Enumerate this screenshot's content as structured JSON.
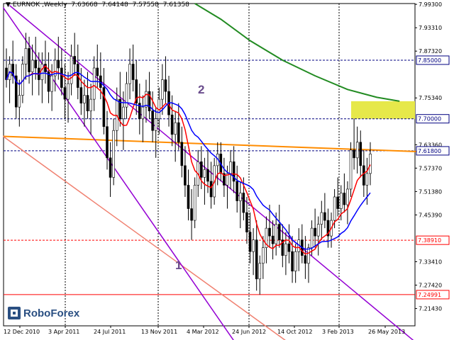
{
  "header": {
    "symbol": "EURNOK",
    "timeframe": "Weekly",
    "ohlc": [
      "7.63668",
      "7.64148",
      "7.57558",
      "7.61358"
    ]
  },
  "logo": {
    "name": "RoboForex"
  },
  "wave_labels": [
    "1",
    "2"
  ],
  "colors": {
    "background": "#ffffff",
    "candle": "#000000",
    "ma_red": "#ff0000",
    "ma_blue": "#0000ff",
    "ma_green": "#228b22",
    "trend_orange": "#ff8c00",
    "channel_purple": "#9400d3",
    "trend_pink": "#f08070",
    "zone_yellow": "#e6e84a",
    "level_navy": "#000080"
  },
  "chart_data": {
    "type": "candlestick",
    "title": "EURNOK,Weekly",
    "x_tick_labels": [
      "12 Dec 2010",
      "3 Apr 2011",
      "24 Jul 2011",
      "13 Nov 2011",
      "4 Mar 2012",
      "24 Jun 2012",
      "14 Oct 2012",
      "3 Feb 2013",
      "26 May 2013"
    ],
    "y_tick_labels": [
      "7.99300",
      "7.93310",
      "7.87320",
      "7.75340",
      "7.63360",
      "7.57370",
      "7.51380",
      "7.45390",
      "7.33410",
      "7.27420",
      "7.21430"
    ],
    "ylim": [
      7.17,
      7.995
    ],
    "levels": [
      {
        "value": 7.85,
        "label": "7.85000",
        "color": "#000080",
        "style": "dash"
      },
      {
        "value": 7.7,
        "label": "7.70000",
        "color": "#000080",
        "style": "dash"
      },
      {
        "value": 7.618,
        "label": "7.61800",
        "color": "#000080",
        "style": "dash"
      },
      {
        "value": 7.3891,
        "label": "7.38910",
        "color": "#ff0000",
        "style": "dash"
      },
      {
        "value": 7.2499,
        "label": "7.24991",
        "color": "#ff0000",
        "style": "solid"
      }
    ],
    "target_zone": {
      "from": 7.7,
      "to": 7.745
    },
    "price_series": [
      [
        7.83,
        7.88,
        7.78,
        7.8
      ],
      [
        7.8,
        7.86,
        7.74,
        7.84
      ],
      [
        7.84,
        7.9,
        7.79,
        7.81
      ],
      [
        7.81,
        7.84,
        7.7,
        7.73
      ],
      [
        7.73,
        7.8,
        7.68,
        7.76
      ],
      [
        7.76,
        7.86,
        7.74,
        7.84
      ],
      [
        7.84,
        7.92,
        7.8,
        7.88
      ],
      [
        7.88,
        7.91,
        7.79,
        7.82
      ],
      [
        7.82,
        7.89,
        7.76,
        7.85
      ],
      [
        7.85,
        7.91,
        7.8,
        7.83
      ],
      [
        7.83,
        7.87,
        7.76,
        7.8
      ],
      [
        7.8,
        7.87,
        7.74,
        7.84
      ],
      [
        7.84,
        7.9,
        7.79,
        7.82
      ],
      [
        7.82,
        7.87,
        7.74,
        7.77
      ],
      [
        7.77,
        7.84,
        7.72,
        7.81
      ],
      [
        7.81,
        7.88,
        7.77,
        7.85
      ],
      [
        7.85,
        7.91,
        7.8,
        7.83
      ],
      [
        7.83,
        7.88,
        7.76,
        7.78
      ],
      [
        7.78,
        7.84,
        7.7,
        7.75
      ],
      [
        7.75,
        7.82,
        7.69,
        7.79
      ],
      [
        7.79,
        7.89,
        7.76,
        7.86
      ],
      [
        7.86,
        7.92,
        7.81,
        7.84
      ],
      [
        7.84,
        7.89,
        7.75,
        7.78
      ],
      [
        7.78,
        7.83,
        7.71,
        7.74
      ],
      [
        7.74,
        7.8,
        7.68,
        7.76
      ],
      [
        7.76,
        7.82,
        7.7,
        7.72
      ],
      [
        7.72,
        7.79,
        7.66,
        7.75
      ],
      [
        7.75,
        7.86,
        7.72,
        7.83
      ],
      [
        7.83,
        7.89,
        7.78,
        7.81
      ],
      [
        7.81,
        7.87,
        7.75,
        7.78
      ],
      [
        7.78,
        7.83,
        7.66,
        7.68
      ],
      [
        7.68,
        7.72,
        7.57,
        7.6
      ],
      [
        7.6,
        7.64,
        7.5,
        7.55
      ],
      [
        7.55,
        7.7,
        7.53,
        7.67
      ],
      [
        7.67,
        7.78,
        7.63,
        7.75
      ],
      [
        7.75,
        7.82,
        7.68,
        7.7
      ],
      [
        7.7,
        7.77,
        7.62,
        7.73
      ],
      [
        7.73,
        7.82,
        7.7,
        7.79
      ],
      [
        7.79,
        7.88,
        7.75,
        7.84
      ],
      [
        7.84,
        7.89,
        7.77,
        7.8
      ],
      [
        7.8,
        7.85,
        7.71,
        7.74
      ],
      [
        7.74,
        7.79,
        7.66,
        7.7
      ],
      [
        7.7,
        7.76,
        7.64,
        7.73
      ],
      [
        7.73,
        7.8,
        7.69,
        7.77
      ],
      [
        7.77,
        7.82,
        7.7,
        7.72
      ],
      [
        7.72,
        7.77,
        7.64,
        7.67
      ],
      [
        7.67,
        7.73,
        7.6,
        7.7
      ],
      [
        7.7,
        7.78,
        7.66,
        7.75
      ],
      [
        7.75,
        7.84,
        7.71,
        7.8
      ],
      [
        7.8,
        7.86,
        7.74,
        7.77
      ],
      [
        7.77,
        7.81,
        7.68,
        7.71
      ],
      [
        7.71,
        7.76,
        7.63,
        7.66
      ],
      [
        7.66,
        7.72,
        7.59,
        7.69
      ],
      [
        7.69,
        7.74,
        7.62,
        7.64
      ],
      [
        7.64,
        7.68,
        7.55,
        7.58
      ],
      [
        7.58,
        7.63,
        7.5,
        7.53
      ],
      [
        7.53,
        7.57,
        7.44,
        7.47
      ],
      [
        7.47,
        7.52,
        7.39,
        7.44
      ],
      [
        7.44,
        7.55,
        7.42,
        7.53
      ],
      [
        7.53,
        7.62,
        7.5,
        7.59
      ],
      [
        7.59,
        7.63,
        7.52,
        7.55
      ],
      [
        7.55,
        7.6,
        7.48,
        7.57
      ],
      [
        7.57,
        7.62,
        7.51,
        7.54
      ],
      [
        7.54,
        7.59,
        7.47,
        7.5
      ],
      [
        7.5,
        7.6,
        7.48,
        7.58
      ],
      [
        7.58,
        7.64,
        7.53,
        7.61
      ],
      [
        7.61,
        7.64,
        7.54,
        7.56
      ],
      [
        7.56,
        7.6,
        7.5,
        7.53
      ],
      [
        7.53,
        7.58,
        7.47,
        7.56
      ],
      [
        7.56,
        7.62,
        7.52,
        7.59
      ],
      [
        7.59,
        7.63,
        7.51,
        7.54
      ],
      [
        7.54,
        7.58,
        7.46,
        7.49
      ],
      [
        7.49,
        7.54,
        7.42,
        7.51
      ],
      [
        7.51,
        7.55,
        7.44,
        7.46
      ],
      [
        7.46,
        7.5,
        7.38,
        7.41
      ],
      [
        7.41,
        7.46,
        7.33,
        7.36
      ],
      [
        7.36,
        7.42,
        7.3,
        7.39
      ],
      [
        7.39,
        7.44,
        7.26,
        7.29
      ],
      [
        7.29,
        7.35,
        7.25,
        7.33
      ],
      [
        7.33,
        7.4,
        7.29,
        7.37
      ],
      [
        7.37,
        7.45,
        7.33,
        7.42
      ],
      [
        7.42,
        7.48,
        7.37,
        7.4
      ],
      [
        7.4,
        7.44,
        7.34,
        7.38
      ],
      [
        7.38,
        7.46,
        7.35,
        7.43
      ],
      [
        7.43,
        7.48,
        7.37,
        7.39
      ],
      [
        7.39,
        7.43,
        7.32,
        7.35
      ],
      [
        7.35,
        7.41,
        7.3,
        7.38
      ],
      [
        7.38,
        7.43,
        7.33,
        7.36
      ],
      [
        7.36,
        7.4,
        7.28,
        7.31
      ],
      [
        7.31,
        7.38,
        7.28,
        7.36
      ],
      [
        7.36,
        7.42,
        7.31,
        7.39
      ],
      [
        7.39,
        7.43,
        7.33,
        7.35
      ],
      [
        7.35,
        7.4,
        7.29,
        7.33
      ],
      [
        7.33,
        7.38,
        7.28,
        7.37
      ],
      [
        7.37,
        7.44,
        7.35,
        7.42
      ],
      [
        7.42,
        7.47,
        7.37,
        7.4
      ],
      [
        7.4,
        7.45,
        7.35,
        7.43
      ],
      [
        7.43,
        7.49,
        7.39,
        7.46
      ],
      [
        7.46,
        7.51,
        7.42,
        7.44
      ],
      [
        7.44,
        7.47,
        7.37,
        7.4
      ],
      [
        7.4,
        7.46,
        7.37,
        7.44
      ],
      [
        7.44,
        7.52,
        7.42,
        7.5
      ],
      [
        7.5,
        7.55,
        7.45,
        7.47
      ],
      [
        7.47,
        7.53,
        7.44,
        7.51
      ],
      [
        7.51,
        7.56,
        7.46,
        7.48
      ],
      [
        7.48,
        7.54,
        7.43,
        7.52
      ],
      [
        7.52,
        7.64,
        7.5,
        7.62
      ],
      [
        7.62,
        7.7,
        7.57,
        7.6
      ],
      [
        7.6,
        7.68,
        7.56,
        7.64
      ],
      [
        7.64,
        7.67,
        7.55,
        7.58
      ],
      [
        7.58,
        7.62,
        7.5,
        7.53
      ],
      [
        7.53,
        7.6,
        7.48,
        7.56
      ],
      [
        7.56,
        7.64,
        7.53,
        7.61
      ]
    ]
  }
}
